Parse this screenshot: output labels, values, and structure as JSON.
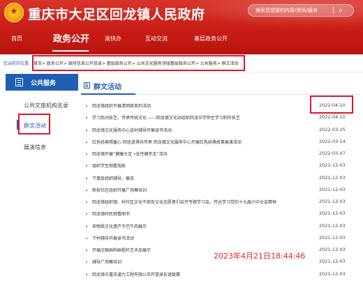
{
  "header": {
    "site_title": "重庆市大足区回龙镇人民政府",
    "search_placeholder": "搜索您想要的内容/资讯/服务",
    "search_icon": "search-icon"
  },
  "nav": {
    "items": [
      {
        "label": "首页"
      },
      {
        "label": "政务公开"
      },
      {
        "label": "渝快办"
      },
      {
        "label": "互动交流"
      },
      {
        "label": "基层政务公开"
      }
    ]
  },
  "breadcrumb": {
    "location_label": "您当前的位置:",
    "path": "首页> 政务公开> 政府信息公开目录> 基层政务公开> 公共文化服务领域基层政务公开> 公共服务> 群文活动"
  },
  "sidebar": {
    "header": "公共服务",
    "items": [
      {
        "label": "公共文旅机构名录"
      },
      {
        "label": "群文活动"
      },
      {
        "label": "展演信息"
      }
    ]
  },
  "main": {
    "title": "群文活动",
    "rows": [
      {
        "title": "回龙镇组织开展清明祭英烈活动",
        "date": "2022-04-10"
      },
      {
        "title": "学习民间技艺，传承传统文化 ——回龙镇文化站组织回龙中学师生学习制作技艺",
        "date": "2022-04-10"
      },
      {
        "title": "回龙镇文化服务中心送村辅导开展读书活动",
        "date": "2022-03-25"
      },
      {
        "title": "红色经典照童心 回径道得共传承 回龙镇文化服务中心开展红色经典故事展演活动",
        "date": "2022-03-14"
      },
      {
        "title": "回龙镇开展“健康大足 •女性健步走”活动",
        "date": "2022-03-07"
      },
      {
        "title": "组织学生观看电影",
        "date": "2021-12-03"
      },
      {
        "title": "下基层组织辅导、展览",
        "date": "2021-12-03"
      },
      {
        "title": "新权社区组织开展广场舞培训",
        "date": "2021-12-03"
      },
      {
        "title": "回龙镇组织镇、村社区文化干部及文化志愿者们召开专题学习会，传达学习党的十九届六中全会精神",
        "date": "2021-12-03"
      },
      {
        "title": "回龙镇村民观看图书",
        "date": "2021-12-03"
      },
      {
        "title": "非物质文化遗产于巴牛肉展示",
        "date": "2021-12-03"
      },
      {
        "title": "下村辅导开展读书活动",
        "date": "2021-12-03"
      },
      {
        "title": "开展庄毓画和画棍杆艺术品展示",
        "date": "2021-12-03"
      },
      {
        "title": "辅导广场舞培训",
        "date": "2021-12-03"
      },
      {
        "title": "回龙镇与重庆通力工程有限公司开篮球友谊联赛",
        "date": "2021-12-03"
      }
    ]
  },
  "watermark": "2023年4月21日18:44:46",
  "colors": {
    "brand_red": "#c81d16",
    "accent_blue": "#1e5fb4",
    "highlight_red": "#e0142c"
  }
}
